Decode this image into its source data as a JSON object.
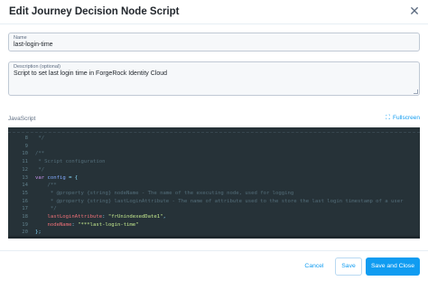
{
  "dialog": {
    "title": "Edit Journey Decision Node Script",
    "close_glyph": "✕"
  },
  "form": {
    "name": {
      "label": "Name",
      "value": "last-login-time"
    },
    "description": {
      "label": "Description (optional)",
      "value": "Script to set last login time in ForgeRock Identity Cloud"
    }
  },
  "editor": {
    "label": "JavaScript",
    "fullscreen_label": "Fullscreen",
    "fullscreen_icon": "⛶",
    "lines": [
      {
        "num": "8",
        "tokens": [
          {
            "t": " */",
            "c": "comment"
          }
        ]
      },
      {
        "num": "9",
        "tokens": []
      },
      {
        "num": "10",
        "tokens": [
          {
            "t": "/**",
            "c": "comment"
          }
        ]
      },
      {
        "num": "11",
        "tokens": [
          {
            "t": " * Script configuration",
            "c": "comment"
          }
        ]
      },
      {
        "num": "12",
        "tokens": [
          {
            "t": " */",
            "c": "comment"
          }
        ]
      },
      {
        "num": "13",
        "tokens": [
          {
            "t": "var ",
            "c": "keyword"
          },
          {
            "t": "config",
            "c": "var"
          },
          {
            "t": " = {",
            "c": "punc"
          }
        ]
      },
      {
        "num": "14",
        "tokens": [
          {
            "t": "    /**",
            "c": "comment"
          }
        ]
      },
      {
        "num": "15",
        "tokens": [
          {
            "t": "     * @property {string} nodeName - The name of the executing node, used for logging",
            "c": "comment"
          }
        ]
      },
      {
        "num": "16",
        "tokens": [
          {
            "t": "     * @property {string} lastLoginAttribute - The name of attribute used to the store the last login timestamp of a user",
            "c": "comment"
          }
        ]
      },
      {
        "num": "17",
        "tokens": [
          {
            "t": "     */",
            "c": "comment"
          }
        ]
      },
      {
        "num": "18",
        "tokens": [
          {
            "t": "    lastLoginAttribute",
            "c": "prop"
          },
          {
            "t": ": ",
            "c": "punc"
          },
          {
            "t": "\"frUnindexedDate1\"",
            "c": "string"
          },
          {
            "t": ",",
            "c": "punc"
          }
        ]
      },
      {
        "num": "19",
        "tokens": [
          {
            "t": "    nodeName",
            "c": "prop"
          },
          {
            "t": ": ",
            "c": "punc"
          },
          {
            "t": "\"***last-login-time\"",
            "c": "string"
          }
        ]
      },
      {
        "num": "20",
        "tokens": [
          {
            "t": "};",
            "c": "punc"
          }
        ]
      }
    ]
  },
  "footer": {
    "cancel_label": "Cancel",
    "save_label": "Save",
    "save_close_label": "Save and Close"
  },
  "colors": {
    "accent": "#109cf1",
    "editor_bg": "#263238"
  }
}
